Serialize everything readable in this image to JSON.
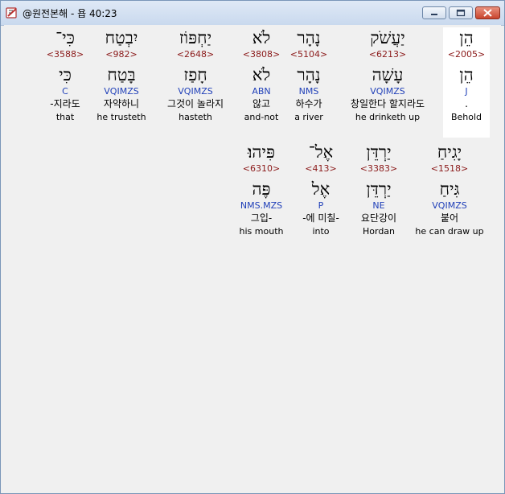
{
  "window": {
    "title": "@원전본해 - 욥 40:23",
    "icon": "bible-app-icon",
    "controls": {
      "minimize": "minimize-icon",
      "maximize": "maximize-icon",
      "close": "close-icon"
    }
  },
  "rows": [
    [
      {
        "heb": "הֵן",
        "strong": "<2005>",
        "lemma": "הֵן",
        "morph": "J",
        "kor": ".",
        "eng": "Behold",
        "highlight": true
      },
      {
        "heb": "יַעֲשֹׁק",
        "strong": "<6213>",
        "lemma": "עָשָׁה",
        "morph": "VQIMZS",
        "kor": "창일한다 할지라도",
        "eng": "he drinketh up"
      },
      {
        "heb": "נָהָר",
        "strong": "<5104>",
        "lemma": "נָהָר",
        "morph": "NMS",
        "kor": "하수가",
        "eng": "a river"
      },
      {
        "heb": "לֹא",
        "strong": "<3808>",
        "lemma": "לֹא",
        "morph": "ABN",
        "kor": "않고",
        "eng": "and-not"
      },
      {
        "heb": "יַחְפּוֹז",
        "strong": "<2648>",
        "lemma": "חָפַז",
        "morph": "VQIMZS",
        "kor": "그것이 놀라지",
        "eng": "hasteth"
      },
      {
        "heb": "יִבְטַח",
        "strong": "<982>",
        "lemma": "בָּטַח",
        "morph": "VQIMZS",
        "kor": "자약하니",
        "eng": "he trusteth"
      },
      {
        "heb": "כִּי־",
        "strong": "<3588>",
        "lemma": "כִּי",
        "morph": "C",
        "kor": "-지라도",
        "eng": "that"
      }
    ],
    [
      {
        "heb": "יָגִיחַ",
        "strong": "<1518>",
        "lemma": "גִּיחַ",
        "morph": "VQIMZS",
        "kor": "붙어",
        "eng": "he can draw up"
      },
      {
        "heb": "יַרְדֵּן",
        "strong": "<3383>",
        "lemma": "יַרְדֵּן",
        "morph": "NE",
        "kor": "요단강이",
        "eng": "Hordan"
      },
      {
        "heb": "אֶל־",
        "strong": "<413>",
        "lemma": "אֶל",
        "morph": "P",
        "kor": "-에 미칠-",
        "eng": "into"
      },
      {
        "heb": "פִּיהוּ׃",
        "strong": "<6310>",
        "lemma": "פֶּה",
        "morph": "NMS.MZS",
        "kor": "그입-",
        "eng": "his mouth"
      }
    ]
  ]
}
